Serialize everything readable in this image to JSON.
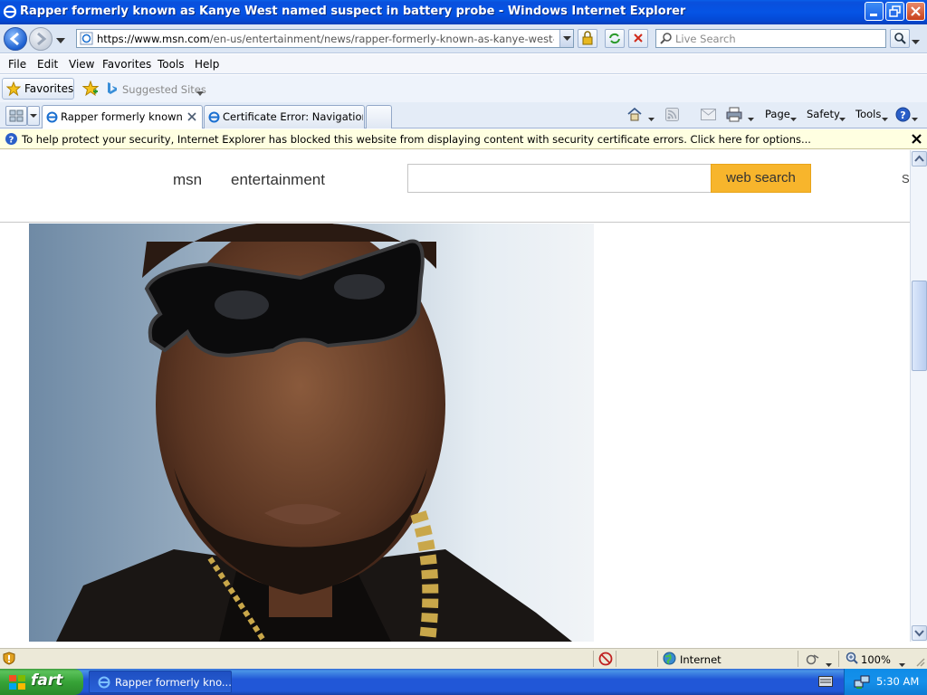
{
  "window": {
    "title": "Rapper formerly known as Kanye West named suspect in battery probe - Windows Internet Explorer"
  },
  "address": {
    "scheme": "https://",
    "host": "www.msn.com",
    "path": "/en-us/entertainment/news/rapper-formerly-known-as-kanye-west-named-suspect"
  },
  "search": {
    "placeholder": "Live Search"
  },
  "menu": {
    "items": [
      "File",
      "Edit",
      "View",
      "Favorites",
      "Tools",
      "Help"
    ]
  },
  "favorites_bar": {
    "favorites_label": "Favorites",
    "suggested_label": "Suggested Sites"
  },
  "tabs": [
    {
      "label": "Rapper formerly known a..."
    },
    {
      "label": "Certificate Error: Navigation ..."
    }
  ],
  "commandbar": {
    "page": "Page",
    "safety": "Safety",
    "tools": "Tools"
  },
  "infobar": {
    "message": "To help protect your security, Internet Explorer has blocked this website from displaying content with security certificate errors. Click here for options..."
  },
  "page": {
    "logo": "msn",
    "section": "entertainment",
    "search_button": "web search",
    "signin_partial": "Si"
  },
  "statusbar": {
    "zone": "Internet",
    "zoom": "100%"
  },
  "taskbar": {
    "start": "fart",
    "task": "Rapper formerly kno...",
    "clock": "5:30 AM"
  },
  "colors": {
    "accent": "#f7b52c",
    "titlebar": "#0554e5",
    "infobar": "#ffffe1"
  }
}
